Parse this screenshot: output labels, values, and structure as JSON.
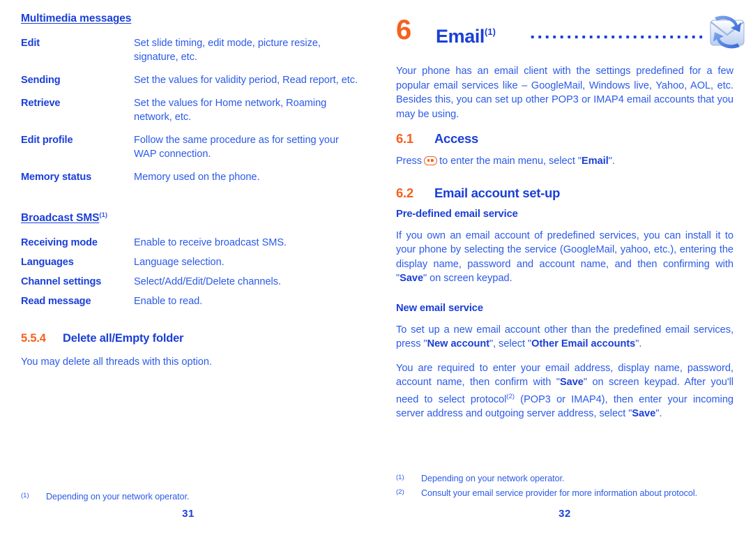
{
  "left_page": {
    "section_heading": "Multimedia messages",
    "mms_rows": [
      {
        "term": "Edit",
        "desc": "Set slide timing, edit mode, picture resize, signature, etc."
      },
      {
        "term": "Sending",
        "desc": "Set the values for validity period, Read report, etc."
      },
      {
        "term": "Retrieve",
        "desc": "Set the values for Home network, Roaming network, etc."
      },
      {
        "term": "Edit profile",
        "desc": "Follow the same procedure as for setting your WAP connection."
      },
      {
        "term": "Memory status",
        "desc": "Memory used on the phone."
      }
    ],
    "broadcast_heading": "Broadcast SMS",
    "broadcast_heading_sup": "(1)",
    "broadcast_rows": [
      {
        "term": "Receiving mode",
        "desc": "Enable to receive broadcast SMS."
      },
      {
        "term": "Languages",
        "desc": "Language selection."
      },
      {
        "term": "Channel settings",
        "desc": "Select/Add/Edit/Delete channels."
      },
      {
        "term": "Read message",
        "desc": "Enable to read."
      }
    ],
    "subsection": {
      "number": "5.5.4",
      "title": "Delete all/Empty folder",
      "body": "You may delete all threads with this option."
    },
    "footnotes": [
      {
        "mark": "(1)",
        "text": "Depending on your network operator."
      }
    ],
    "page_number": "31"
  },
  "right_page": {
    "chapter": {
      "number": "6",
      "title": "Email",
      "title_sup": "(1)",
      "leader_dots": "...........................................",
      "icon": "email-sync-icon"
    },
    "intro": "Your phone has an email client with the settings predefined for a few popular email services like – GoogleMail, Windows live, Yahoo, AOL, etc. Besides this, you can set up other POP3 or IMAP4 email accounts that you may be using.",
    "access": {
      "number": "6.1",
      "title": "Access",
      "body_before_key": "Press",
      "key_icon": "ok-key-icon",
      "body_after_key_1": "to enter the main menu, select \"",
      "body_bold_1": "Email",
      "body_after_key_2": "\"."
    },
    "account_setup": {
      "number": "6.2",
      "title": "Email account set-up",
      "predefined": {
        "heading": "Pre-defined email service",
        "text_1": "If you own an email account of predefined services, you can install it to your phone by selecting the service (GoogleMail, yahoo, etc.), entering the display name, password and account name, and then confirming with \"",
        "bold_1": "Save",
        "text_2": "\" on screen keypad."
      },
      "new_service": {
        "heading": "New email service",
        "p1_text_1": "To set up a new email account other than the predefined email services, press \"",
        "p1_bold_1": "New account",
        "p1_text_2": "\", select \"",
        "p1_bold_2": "Other Email accounts",
        "p1_text_3": "\".",
        "p2_text_1": "You are required to enter your email address, display name, password, account name, then confirm with \"",
        "p2_bold_1": "Save",
        "p2_text_2": "\" on screen keypad. After you'll need to select protocol",
        "p2_sup": "(2)",
        "p2_text_3": "(POP3 or IMAP4), then enter your incoming server address and outgoing server address, select \"",
        "p2_bold_2": "Save",
        "p2_text_4": "\"."
      }
    },
    "footnotes": [
      {
        "mark": "(1)",
        "text": "Depending on your network operator."
      },
      {
        "mark": "(2)",
        "text": "Consult your email service provider for more information about protocol."
      }
    ],
    "page_number": "32"
  },
  "colors": {
    "heading_blue": "#1a3fd8",
    "body_blue": "#2b5ae8",
    "accent_orange": "#f4611f",
    "background": "#ffffff"
  }
}
